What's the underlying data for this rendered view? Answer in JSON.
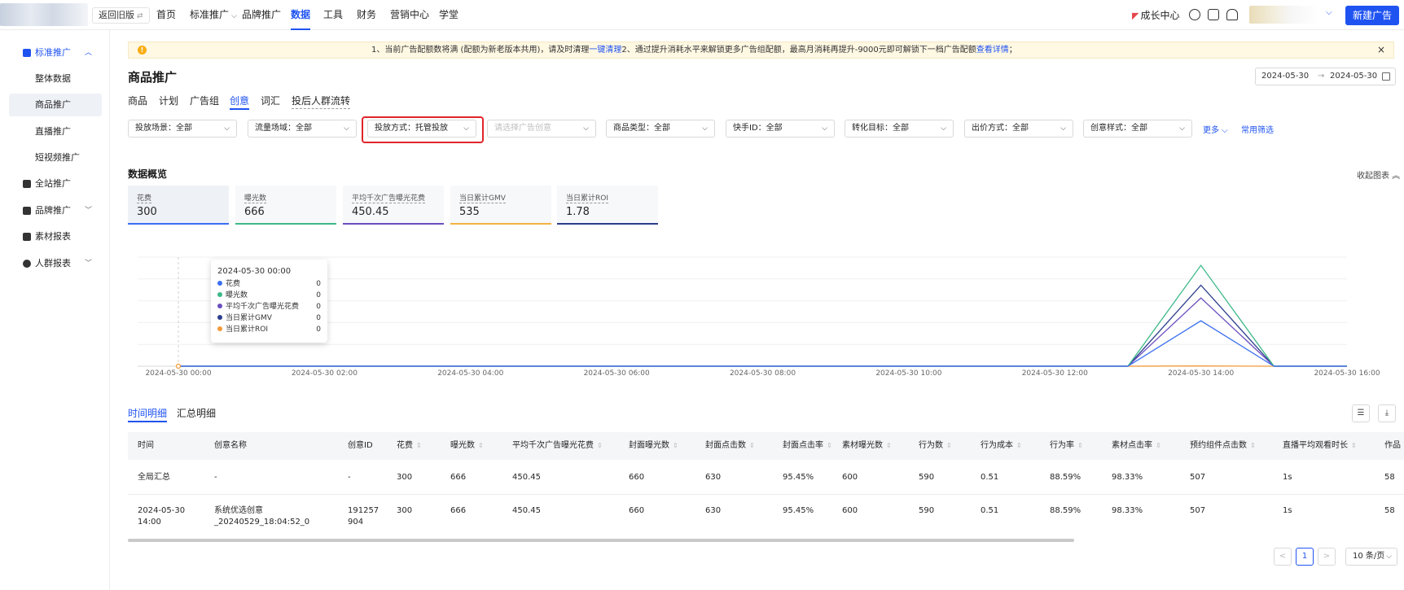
{
  "topbar": {
    "back_label": "返回旧版",
    "nav": [
      "首页",
      "标准推广",
      "品牌推广",
      "数据",
      "工具",
      "财务",
      "营销中心",
      "学堂"
    ],
    "active_nav": "数据",
    "growth_center": "成长中心",
    "new_ad": "新建广告"
  },
  "sidebar": {
    "items": [
      {
        "label": "标准推广",
        "icon": "grid-icon"
      },
      {
        "label": "整体数据"
      },
      {
        "label": "商品推广"
      },
      {
        "label": "直播推广"
      },
      {
        "label": "短视频推广"
      },
      {
        "label": "全站推广",
        "icon": "chart-icon"
      },
      {
        "label": "品牌推广",
        "icon": "diamond-icon"
      },
      {
        "label": "素材报表",
        "icon": "image-icon"
      },
      {
        "label": "人群报表",
        "icon": "user-icon"
      }
    ]
  },
  "notice": {
    "icon": "!",
    "text1": "1、当前广告配额数将满 (配额为新老版本共用)，请及时清理",
    "link1": "一键清理",
    "text2": "2、通过提升消耗水平来解锁更多广告组配额，最高月消耗再提升-9000元即可解锁下一档广告配额",
    "link2": "查看详情",
    "text3": "；",
    "close": "×"
  },
  "page": {
    "title": "商品推广",
    "date_start": "2024-05-30",
    "date_arrow": "→",
    "date_end": "2024-05-30"
  },
  "tabs": [
    "商品",
    "计划",
    "广告组",
    "创意",
    "词汇",
    "投后人群流转"
  ],
  "filters": [
    "投放场景：全部",
    "流量场域：全部",
    "投放方式：托管投放",
    "请选择广告创意",
    "商品类型：全部",
    "快手ID：全部",
    "转化目标：全部",
    "出价方式：全部",
    "创意样式：全部"
  ],
  "filter_actions": {
    "more": "更多",
    "common": "常用筛选"
  },
  "overview": {
    "title": "数据概览",
    "collapse": "收起图表",
    "cards": [
      {
        "label": "花费",
        "value": "300",
        "color": "#3a6ff0"
      },
      {
        "label": "曝光数",
        "value": "666",
        "color": "#3db888"
      },
      {
        "label": "平均千次广告曝光花费",
        "value": "450.45",
        "color": "#6b4fbf"
      },
      {
        "label": "当日累计GMV",
        "value": "535",
        "color": "#f2b441"
      },
      {
        "label": "当日累计ROI",
        "value": "1.78",
        "color": "#2c3e8c"
      }
    ]
  },
  "chart_data": {
    "type": "line",
    "x_ticks": [
      "2024-05-30 00:00",
      "2024-05-30 02:00",
      "2024-05-30 04:00",
      "2024-05-30 06:00",
      "2024-05-30 08:00",
      "2024-05-30 10:00",
      "2024-05-30 12:00",
      "2024-05-30 14:00",
      "2024-05-30 16:00"
    ],
    "x": [
      "00:00",
      "01:00",
      "02:00",
      "03:00",
      "04:00",
      "05:00",
      "06:00",
      "07:00",
      "08:00",
      "09:00",
      "10:00",
      "11:00",
      "12:00",
      "13:00",
      "14:00",
      "15:00",
      "16:00"
    ],
    "series": [
      {
        "name": "花费",
        "color": "#3a6ff0",
        "values": [
          0,
          0,
          0,
          0,
          0,
          0,
          0,
          0,
          0,
          0,
          0,
          0,
          0,
          0,
          300,
          0,
          0
        ]
      },
      {
        "name": "曝光数",
        "color": "#3db888",
        "values": [
          0,
          0,
          0,
          0,
          0,
          0,
          0,
          0,
          0,
          0,
          0,
          0,
          0,
          0,
          666,
          0,
          0
        ]
      },
      {
        "name": "平均千次广告曝光花费",
        "color": "#6b4fbf",
        "values": [
          0,
          0,
          0,
          0,
          0,
          0,
          0,
          0,
          0,
          0,
          0,
          0,
          0,
          0,
          450.45,
          0,
          0
        ]
      },
      {
        "name": "当日累计GMV",
        "color": "#2c3e8c",
        "values": [
          0,
          0,
          0,
          0,
          0,
          0,
          0,
          0,
          0,
          0,
          0,
          0,
          0,
          0,
          535,
          0,
          0
        ]
      },
      {
        "name": "当日累计ROI",
        "color": "#f29a3a",
        "values": [
          0,
          0,
          0,
          0,
          0,
          0,
          0,
          0,
          0,
          0,
          0,
          0,
          0,
          0,
          1.78,
          0,
          0
        ]
      }
    ],
    "ylim": [
      0,
      720
    ],
    "grid": true,
    "tooltip": {
      "title": "2024-05-30 00:00",
      "rows": [
        {
          "name": "花费",
          "value": "0",
          "color": "#3a6ff0"
        },
        {
          "name": "曝光数",
          "value": "0",
          "color": "#3db888"
        },
        {
          "name": "平均千次广告曝光花费",
          "value": "0",
          "color": "#6b4fbf"
        },
        {
          "name": "当日累计GMV",
          "value": "0",
          "color": "#2c3e8c"
        },
        {
          "name": "当日累计ROI",
          "value": "0",
          "color": "#f29a3a"
        }
      ]
    }
  },
  "detail": {
    "tabs": [
      "时间明细",
      "汇总明细"
    ],
    "headers": [
      "时间",
      "创意名称",
      "创意ID",
      "花费",
      "曝光数",
      "平均千次广告曝光花费",
      "封面曝光数",
      "封面点击数",
      "封面点击率",
      "素材曝光数",
      "行为数",
      "行为成本",
      "行为率",
      "素材点击率",
      "预约组件点击数",
      "直播平均观看时长",
      "作品"
    ],
    "rows": [
      [
        "全局汇总",
        "-",
        "-",
        "300",
        "666",
        "450.45",
        "660",
        "630",
        "95.45%",
        "600",
        "590",
        "0.51",
        "88.59%",
        "98.33%",
        "507",
        "1s",
        "58"
      ],
      [
        "2024-05-30\n14:00",
        "系统优选创意\n_20240529_18:04:52_0",
        "191257\n904",
        "300",
        "666",
        "450.45",
        "660",
        "630",
        "95.45%",
        "600",
        "590",
        "0.51",
        "88.59%",
        "98.33%",
        "507",
        "1s",
        "58"
      ]
    ]
  },
  "pagination": {
    "prev": "<",
    "current": "1",
    "next": ">",
    "page_size": "10 条/页"
  }
}
